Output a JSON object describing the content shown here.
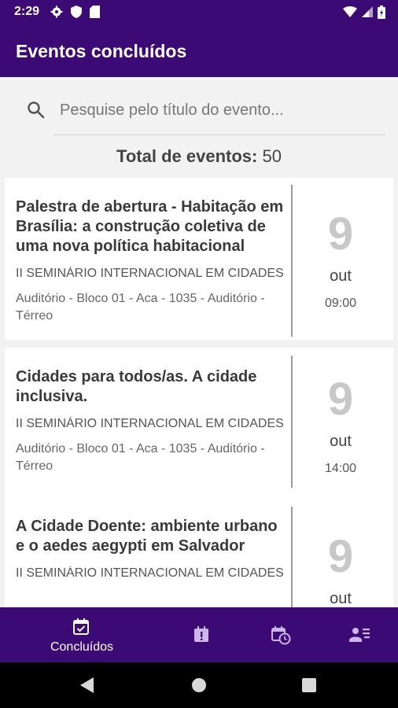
{
  "status_bar": {
    "time": "2:29"
  },
  "app_bar": {
    "title": "Eventos concluídos"
  },
  "search": {
    "placeholder": "Pesquise pelo título do evento..."
  },
  "total": {
    "label": "Total de eventos:",
    "value": "50"
  },
  "events": [
    {
      "title": "Palestra de abertura - Habitação em Brasília: a construção coletiva de uma nova política habitacional",
      "event": "II SEMINÁRIO INTERNACIONAL EM CIDADES",
      "location": "Auditório - Bloco 01 - Aca - 1035 - Auditório - Térreo",
      "day": "9",
      "month": "out",
      "time": "09:00"
    },
    {
      "title": "Cidades para todos/as. A cidade inclusiva.",
      "event": "II SEMINÁRIO INTERNACIONAL EM CIDADES",
      "location": "Auditório - Bloco 01 - Aca - 1035 - Auditório - Térreo",
      "day": "9",
      "month": "out",
      "time": "14:00"
    },
    {
      "title": "A Cidade Doente: ambiente urbano e o aedes aegypti em Salvador",
      "event": "II SEMINÁRIO INTERNACIONAL EM CIDADES",
      "location": "",
      "day": "9",
      "month": "out",
      "time": ""
    }
  ],
  "bottom_nav": {
    "items": [
      {
        "label": "Concluídos",
        "icon": "calendar-check-icon",
        "active": true
      },
      {
        "label": "",
        "icon": "calendar-alert-icon",
        "active": false
      },
      {
        "label": "",
        "icon": "calendar-clock-icon",
        "active": false
      },
      {
        "label": "",
        "icon": "contacts-icon",
        "active": false
      }
    ]
  },
  "colors": {
    "primary": "#3b0a75",
    "day_number": "#c8c8c8"
  }
}
